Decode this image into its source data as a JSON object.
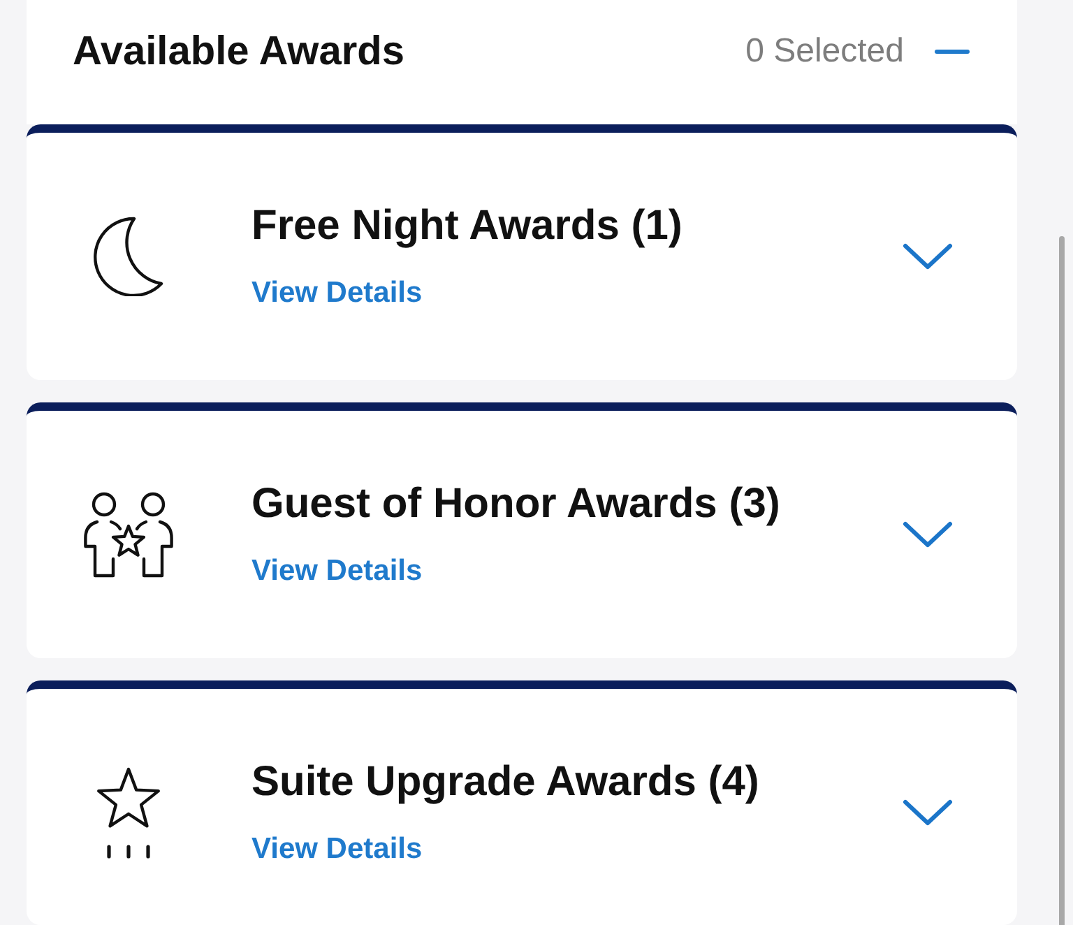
{
  "header": {
    "title": "Available Awards",
    "selected_count": "0 Selected",
    "expanded": true
  },
  "award_categories": [
    {
      "kind": "free_night",
      "title": "Free Night Awards (1)",
      "link": "View Details",
      "expanded": false
    },
    {
      "kind": "guest_of_honor",
      "title": "Guest of Honor Awards (3)",
      "link": "View Details",
      "expanded": false
    },
    {
      "kind": "suite_upgrade",
      "title": "Suite Upgrade Awards (4)",
      "link": "View Details",
      "expanded": false
    }
  ]
}
